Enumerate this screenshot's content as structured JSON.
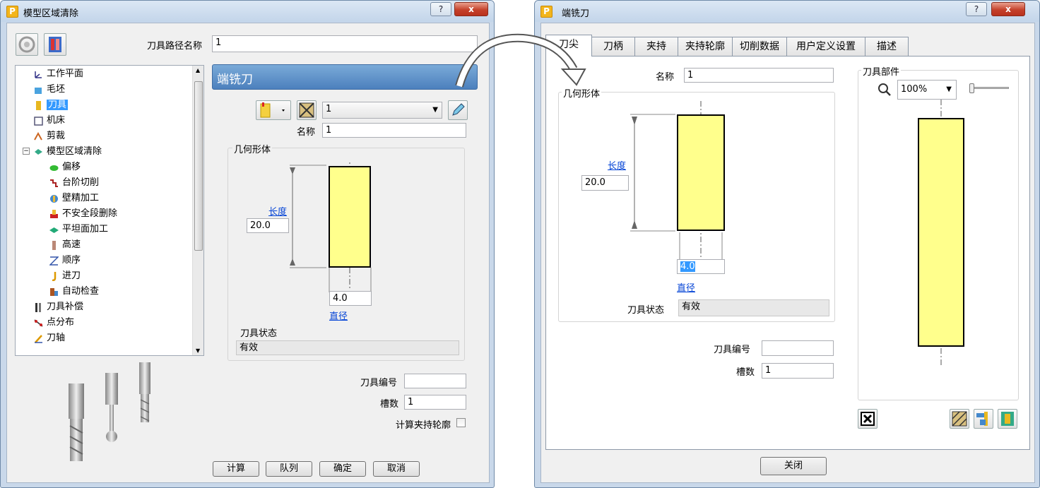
{
  "left_window": {
    "title": "模型区域清除",
    "help_label": "?",
    "close_label": "x",
    "toolpath_name_label": "刀具路径名称",
    "toolpath_name_value": "1",
    "tree_items": [
      "工作平面",
      "毛坯",
      "刀具",
      "机床",
      "剪裁",
      "模型区域清除",
      "偏移",
      "台阶切削",
      "壁精加工",
      "不安全段删除",
      "平坦面加工",
      "高速",
      "顺序",
      "进刀",
      "自动检查",
      "刀具补偿",
      "点分布",
      "刀轴"
    ],
    "panel_title": "端铣刀",
    "tool_select_value": "1",
    "name_label": "名称",
    "name_value": "1",
    "geometry_label": "几何形体",
    "length_link": "长度",
    "length_value": "20.0",
    "diameter_value": "4.0",
    "diameter_link": "直径",
    "tool_state_label": "刀具状态",
    "tool_state_value": "有效",
    "tool_number_label": "刀具编号",
    "tool_number_value": "",
    "flutes_label": "槽数",
    "flutes_value": "1",
    "compute_holder_label": "计算夹持轮廓",
    "buttons": {
      "calculate": "计算",
      "queue": "队列",
      "ok": "确定",
      "cancel": "取消"
    }
  },
  "right_window": {
    "title": "端铣刀",
    "help_label": "?",
    "close_label": "x",
    "tabs": [
      "刀尖",
      "刀柄",
      "夹持",
      "夹持轮廓",
      "切削数据",
      "用户定义设置",
      "描述"
    ],
    "name_label": "名称",
    "name_value": "1",
    "geometry_label": "几何形体",
    "length_link": "长度",
    "length_value": "20.0",
    "diameter_value": "4.0",
    "diameter_link": "直径",
    "tool_state_label": "刀具状态",
    "tool_state_value": "有效",
    "tool_number_label": "刀具编号",
    "tool_number_value": "",
    "flutes_label": "槽数",
    "flutes_value": "1",
    "parts_label": "刀具部件",
    "zoom_value": "100%",
    "close_button": "关闭"
  },
  "colors": {
    "tool_fill": "#ffff8c",
    "panel_header": "#5b8fc7",
    "link": "#0645d6"
  }
}
